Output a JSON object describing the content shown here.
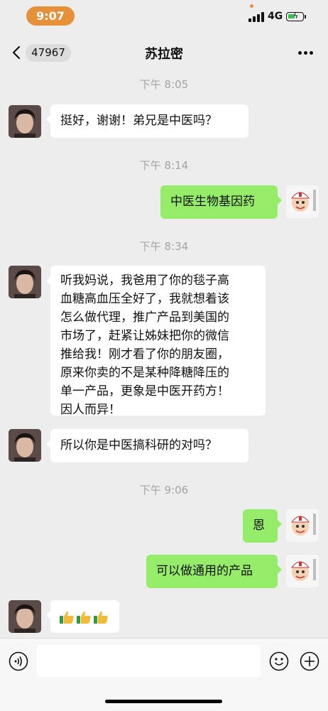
{
  "status_bar": {
    "time": "9:07",
    "network": "4G",
    "battery_level": 0.45
  },
  "nav": {
    "back_badge": "47967",
    "title": "苏拉密",
    "more_icon": "more-dots-icon"
  },
  "colors": {
    "incoming_bubble": "#ffffff",
    "outgoing_bubble": "#95ec69",
    "background": "#ededed",
    "status_time_pill": "#e7903a"
  },
  "messages": [
    {
      "timestamp": "下午 8:05"
    },
    {
      "direction": "in",
      "text": "挺好，谢谢！弟兄是中医吗？"
    },
    {
      "timestamp": "下午 8:14"
    },
    {
      "direction": "out",
      "text": "中医生物基因药"
    },
    {
      "timestamp": "下午 8:34"
    },
    {
      "direction": "in",
      "lines": [
        "听我妈说，我爸用了你的毯子高",
        "血糖高血压全好了，我就想着该",
        "怎么做代理，推广产品到美国的",
        "市场了，赶紧让姊妹把你的微信",
        "推给我！刚才看了你的朋友圈，",
        "原来你卖的不是某种降糖降压的",
        "单一产品，更象是中医开药方！",
        "因人而异！"
      ]
    },
    {
      "direction": "in",
      "text": "所以你是中医搞科研的对吗？"
    },
    {
      "timestamp": "下午 9:06"
    },
    {
      "direction": "out",
      "text": "恩"
    },
    {
      "direction": "out",
      "text": "可以做通用的产品"
    },
    {
      "direction": "in",
      "emoji": [
        "thumbs-up",
        "thumbs-up",
        "thumbs-up"
      ]
    }
  ],
  "input_bar": {
    "voice_icon": "voice-icon",
    "emoji_icon": "emoji-icon",
    "add_icon": "add-icon"
  }
}
